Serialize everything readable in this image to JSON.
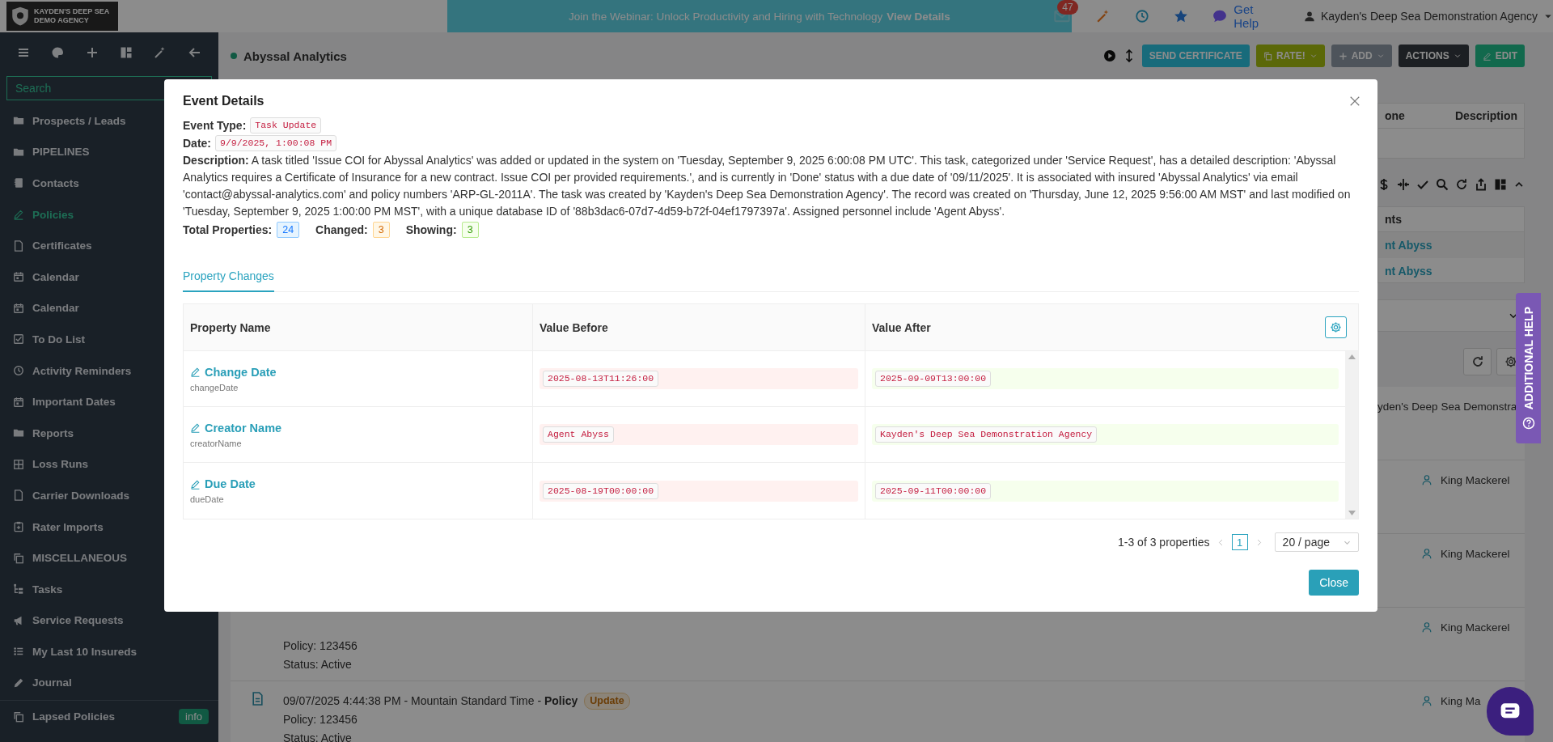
{
  "topbar": {
    "logo_lines": [
      "KAYDEN'S DEEP SEA",
      "DEMO AGENCY"
    ],
    "banner_text": "Join the Webinar: Unlock Productivity and Hiring with Technology",
    "banner_link": "View Details",
    "mail_count": "47",
    "help_label": "Get Help",
    "user_name": "Kayden's Deep Sea Demonstration Agency"
  },
  "sidebar": {
    "search": {
      "placeholder": "Search"
    },
    "groups": [
      {
        "items": [
          {
            "label": "Prospects / Leads",
            "selected": false
          },
          {
            "label": "PIPELINES",
            "selected": false
          },
          {
            "label": "Contacts",
            "selected": false
          },
          {
            "label": "Policies",
            "selected": true
          },
          {
            "label": "Certificates",
            "selected": false
          },
          {
            "label": "Calendar",
            "selected": false
          },
          {
            "label": "Calendar",
            "selected": false
          },
          {
            "label": "To Do List",
            "selected": false
          },
          {
            "label": "Activity Reminders",
            "selected": false
          },
          {
            "label": "Important Dates",
            "selected": false
          },
          {
            "label": "Reports",
            "selected": false
          },
          {
            "label": "Loss Runs",
            "selected": false
          },
          {
            "label": "Carrier Downloads",
            "selected": false
          },
          {
            "label": "Rater Imports",
            "selected": false
          },
          {
            "label": "MISCELLANEOUS",
            "selected": false
          },
          {
            "label": "Tasks",
            "selected": false
          },
          {
            "label": "Service Requests",
            "selected": false
          },
          {
            "label": "My Last 10 Insureds",
            "selected": false
          },
          {
            "label": "Journal",
            "selected": false
          }
        ]
      },
      {
        "items": [
          {
            "label": "Lapsed Policies",
            "selected": false,
            "badge": "info"
          }
        ]
      }
    ]
  },
  "record": {
    "title": "Abyssal Analytics",
    "buttons": [
      {
        "label": "SEND CERTIFICATE",
        "kind": "info",
        "menu": false
      },
      {
        "label": "RATE!",
        "kind": "olive",
        "menu": true
      },
      {
        "label": "ADD",
        "kind": "disabled",
        "menu": true
      },
      {
        "label": "ACTIONS",
        "kind": "dark",
        "menu": true
      },
      {
        "label": "EDIT",
        "kind": "success",
        "menu": false
      }
    ]
  },
  "side_panels": {
    "contacts_table": {
      "columns": [
        "one",
        "Description"
      ]
    },
    "agents_table": {
      "column": "nts",
      "rows": [
        "nt Abyss",
        "nt Abyss"
      ]
    }
  },
  "activity": [
    {
      "assigned": "yden's Deep Sea Demonstra",
      "kind": "text"
    },
    {
      "assigned": "King Mackerel",
      "kind": "person"
    },
    {
      "assigned": "King Mackerel",
      "kind": "person"
    },
    {
      "lines": [
        "Policy: 123456",
        "Status: Active"
      ],
      "assigned": "King Mackerel",
      "kind": "person"
    },
    {
      "headline": "09/07/2025 4:44:38 PM - Mountain Standard Time - **Policy**",
      "badge": "Update",
      "lines": [
        "Policy: 123456",
        "Status: Active"
      ],
      "assigned": "King Ma",
      "kind": "person"
    }
  ],
  "modal": {
    "title": "Event Details",
    "event_type_label": "Event Type:",
    "event_type": "Task Update",
    "date_label": "Date:",
    "date": "9/9/2025, 1:00:08 PM",
    "description": "**Description:** A task titled 'Issue COI for Abyssal Analytics' was added or updated in the system on 'Tuesday, September 9, 2025 6:00:08 PM UTC'. This task, categorized under 'Service Request', has a detailed description: 'Abyssal Analytics requires a Certificate of Insurance for a new contract. Issue COI per provided requirements.', and is currently in 'Done' status with a due date of '09/11/2025'. It is associated with insured 'Abyssal Analytics' via email 'contact@abyssal-analytics.com' and policy numbers 'ARP-GL-2011A'. The task was created by 'Kayden's Deep Sea Demonstration Agency'. The record was created on 'Thursday, June 12, 2025 9:56:00 AM MST' and last modified on 'Tuesday, September 9, 2025 1:00:00 PM MST', with a unique database ID of '88b3dac6-07d7-4d59-b72f-04ef1797397a'. Assigned personnel include 'Agent Abyss'.",
    "counts": [
      {
        "label": "Total Properties:",
        "value": "24",
        "kind": "info"
      },
      {
        "label": "Changed:",
        "value": "3",
        "kind": "warning"
      },
      {
        "label": "Showing:",
        "value": "3",
        "kind": "success"
      }
    ],
    "tabs": [
      {
        "label": "Property Changes",
        "selected": true
      }
    ],
    "table": {
      "columns": [
        "Property Name",
        "Value Before",
        "Value After"
      ],
      "rows": [
        {
          "name": "Change Date",
          "key": "changeDate",
          "before": "2025-08-13T11:26:00",
          "after": "2025-09-09T13:00:00"
        },
        {
          "name": "Creator Name",
          "key": "creatorName",
          "before": "Agent Abyss",
          "after": "Kayden's Deep Sea Demonstration Agency"
        },
        {
          "name": "Due Date",
          "key": "dueDate",
          "before": "2025-08-19T00:00:00",
          "after": "2025-09-11T00:00:00"
        }
      ]
    },
    "pagination": {
      "summary": "1-3 of 3 properties",
      "pages": [
        {
          "label": "1",
          "selected": true
        }
      ],
      "page_size": "20 / page"
    },
    "close_button": "Close"
  },
  "help_tab": "ADDITIONAL HELP"
}
